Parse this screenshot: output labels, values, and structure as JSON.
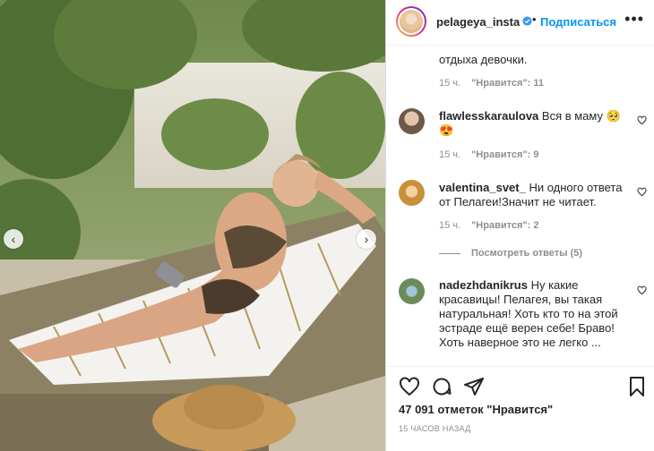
{
  "post": {
    "username": "pelageya_insta",
    "follow_label": "Подписаться",
    "more_label": "•••",
    "dot": "•",
    "likes_text": "47 091 отметок \"Нравится\"",
    "timestamp": "15 ЧАСОВ НАЗАД",
    "nav_prev": "‹",
    "nav_next": "›"
  },
  "comments": [
    {
      "username": "",
      "text": "отдыха девочки.",
      "time": "15 ч.",
      "likes": "\"Нравится\": 11"
    },
    {
      "username": "flawlesskaraulova",
      "text": " Вся в маму 🥺",
      "text2": "😍",
      "time": "15 ч.",
      "likes": "\"Нравится\": 9"
    },
    {
      "username": "valentina_svet_",
      "text": " Ни одного ответа",
      "text2": "от Пелагеи!Значит не читает.",
      "time": "15 ч.",
      "likes": "\"Нравится\": 2",
      "replies": "Посмотреть ответы (5)"
    },
    {
      "username": "nadezhdanikrus",
      "text": " Ну какие",
      "text2": "красавицы! Пелагея, вы такая",
      "text3": "натуральная! Хоть кто то на этой",
      "text4": "эстраде ещё верен себе! Браво!",
      "text5": "Хоть наверное это не легко ..."
    }
  ],
  "icons": {
    "verified": "verified-badge-icon",
    "heart": "heart-icon",
    "comment": "comment-icon",
    "share": "share-icon",
    "save": "bookmark-icon"
  },
  "colors": {
    "link": "#0095f6",
    "text": "#262626",
    "muted": "#8e8e8e"
  }
}
